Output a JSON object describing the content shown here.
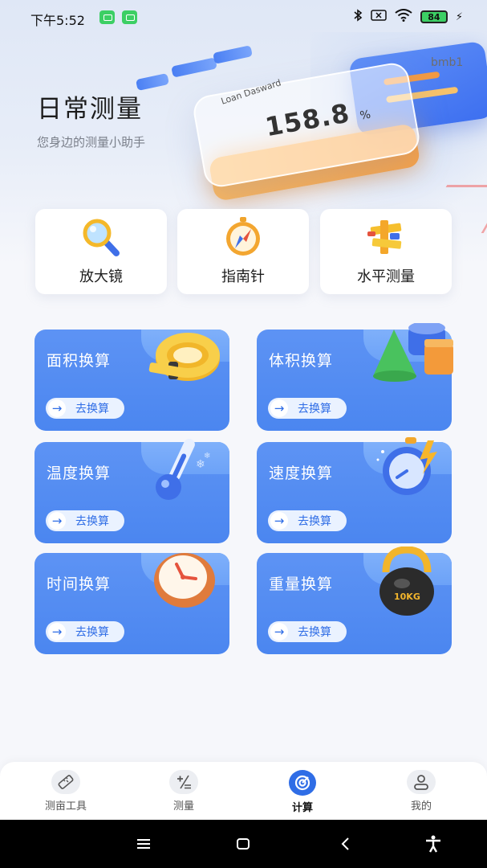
{
  "status_bar": {
    "time": "下午5:52",
    "battery": "84",
    "icons": [
      "app-notification-icon",
      "app-notification-icon",
      "bluetooth-icon",
      "no-sim-icon",
      "wifi-icon",
      "battery-icon",
      "charging-icon"
    ]
  },
  "header": {
    "title": "日常测量",
    "subtitle": "您身边的测量小助手",
    "user_tag": "bmb1",
    "hero_illustration": {
      "card_title": "Loan Dasward",
      "card_value": "158.8",
      "card_unit": "%"
    }
  },
  "tools": [
    {
      "label": "放大镜",
      "icon": "magnifier-icon"
    },
    {
      "label": "指南针",
      "icon": "compass-icon"
    },
    {
      "label": "水平测量",
      "icon": "level-ruler-icon"
    }
  ],
  "conversions": [
    {
      "title": "面积换算",
      "action": "去换算",
      "icon": "tape-measure-icon"
    },
    {
      "title": "体积换算",
      "action": "去换算",
      "icon": "3d-shapes-icon"
    },
    {
      "title": "温度换算",
      "action": "去换算",
      "icon": "thermometer-icon"
    },
    {
      "title": "速度换算",
      "action": "去换算",
      "icon": "stopwatch-icon"
    },
    {
      "title": "时间换算",
      "action": "去换算",
      "icon": "clock-icon"
    },
    {
      "title": "重量换算",
      "action": "去换算",
      "icon": "kettlebell-icon",
      "icon_text": "10KG"
    }
  ],
  "bottom_nav": {
    "items": [
      {
        "label": "测亩工具",
        "icon": "ruler-icon"
      },
      {
        "label": "测量",
        "icon": "plus-minus-icon"
      },
      {
        "label": "计算",
        "icon": "calculate-icon",
        "active": true
      },
      {
        "label": "我的",
        "icon": "profile-icon"
      }
    ]
  },
  "colors": {
    "accent": "#2f6de6",
    "card_blue": "#4b86f0",
    "page_bg": "#f6f7fb"
  }
}
